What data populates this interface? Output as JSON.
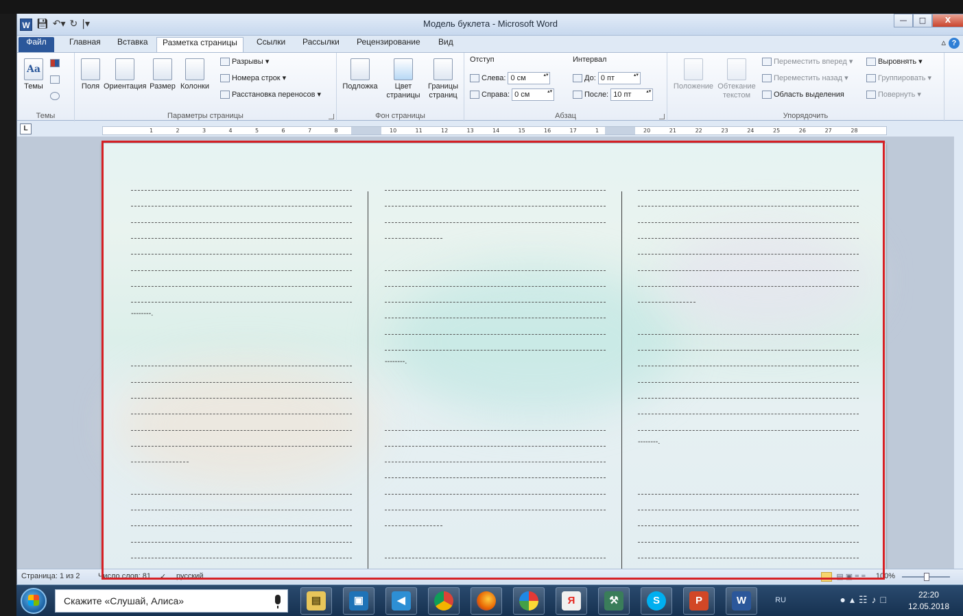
{
  "window": {
    "title": "Модель буклета - Microsoft Word",
    "app_icon": "W",
    "qat": [
      "save-icon",
      "undo-icon",
      "redo-icon",
      "customize-icon"
    ]
  },
  "tabs": [
    "Файл",
    "Главная",
    "Вставка",
    "Разметка страницы",
    "Ссылки",
    "Рассылки",
    "Рецензирование",
    "Вид"
  ],
  "active_tab": "Разметка страницы",
  "ribbon": {
    "themes": {
      "label": "Темы",
      "button": "Темы"
    },
    "page_setup": {
      "label": "Параметры страницы",
      "margins": "Поля",
      "orientation": "Ориентация",
      "size": "Размер",
      "columns": "Колонки",
      "breaks": "Разрывы",
      "line_numbers": "Номера строк",
      "hyphenation": "Расстановка переносов"
    },
    "page_background": {
      "label": "Фон страницы",
      "watermark": "Подложка",
      "page_color_1": "Цвет",
      "page_color_2": "страницы",
      "page_borders_1": "Границы",
      "page_borders_2": "страниц"
    },
    "paragraph": {
      "label": "Абзац",
      "indent_title": "Отступ",
      "indent_left_label": "Слева:",
      "indent_left_value": "0 см",
      "indent_right_label": "Справа:",
      "indent_right_value": "0 см",
      "spacing_title": "Интервал",
      "spacing_before_label": "До:",
      "spacing_before_value": "0 пт",
      "spacing_after_label": "После:",
      "spacing_after_value": "10 пт"
    },
    "arrange": {
      "label": "Упорядочить",
      "position": "Положение",
      "wrap_1": "Обтекание",
      "wrap_2": "текстом",
      "bring_forward": "Переместить вперед",
      "send_backward": "Переместить назад",
      "selection_pane": "Область выделения",
      "align": "Выровнять",
      "group": "Группировать",
      "rotate": "Повернуть"
    }
  },
  "ruler": {
    "left_button": "L",
    "ticks": [
      "1",
      "2",
      "3",
      "4",
      "5",
      "6",
      "7",
      "8",
      "10",
      "11",
      "12",
      "13",
      "14",
      "15",
      "16",
      "17",
      "1",
      "20",
      "21",
      "22",
      "23",
      "24",
      "25",
      "26",
      "27",
      "28"
    ]
  },
  "document": {
    "tail_dots": "--------.",
    "short_dashes": "---------------"
  },
  "statusbar": {
    "page": "Страница: 1 из 2",
    "words": "Число слов: 81",
    "language": "русский",
    "zoom": "100%"
  },
  "taskbar": {
    "search_text": "Скажите «Слушай, Алиса»",
    "apps": [
      "explorer",
      "media-player",
      "speaker",
      "chrome",
      "firefox",
      "color-app",
      "yandex",
      "tool-app",
      "skype",
      "powerpoint",
      "word"
    ],
    "language": "RU",
    "time": "22:20",
    "date": "12.05.2018"
  }
}
